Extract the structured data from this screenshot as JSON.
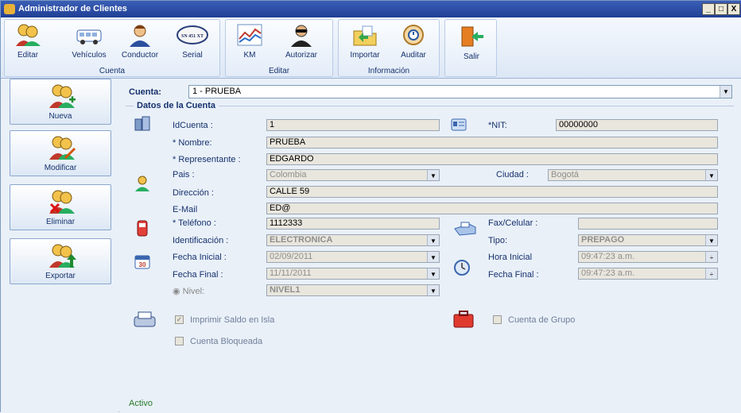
{
  "window": {
    "title": "Administrador de Clientes",
    "controls": [
      "_",
      "□",
      "X"
    ]
  },
  "ribbon": {
    "groups": [
      {
        "title": "Cuenta",
        "buttons": [
          {
            "label": "Editar",
            "icon": "users-icon"
          },
          {
            "label": "Vehículos",
            "icon": "bus-icon"
          },
          {
            "label": "Conductor",
            "icon": "driver-icon"
          },
          {
            "label": "Serial",
            "icon": "serial-tag-icon",
            "badge": "SN 451 XT"
          }
        ]
      },
      {
        "title": "Editar",
        "buttons": [
          {
            "label": "KM",
            "icon": "line-chart-icon"
          },
          {
            "label": "Autorizar",
            "icon": "agent-icon"
          }
        ]
      },
      {
        "title": "Información",
        "buttons": [
          {
            "label": "Importar",
            "icon": "import-folder-icon"
          },
          {
            "label": "Auditar",
            "icon": "audit-clock-icon"
          }
        ]
      },
      {
        "title": "",
        "buttons": [
          {
            "label": "Salir",
            "icon": "exit-door-icon"
          }
        ]
      }
    ]
  },
  "sidebar": {
    "buttons": [
      {
        "label": "Nueva"
      },
      {
        "label": "Modificar"
      },
      {
        "label": "Eliminar"
      },
      {
        "label": "Exportar"
      }
    ]
  },
  "main": {
    "account_label": "Cuenta:",
    "account_value": "1 - PRUEBA",
    "legend": "Datos de la Cuenta",
    "fields": {
      "idcuenta_label": "IdCuenta :",
      "idcuenta_value": "1",
      "nit_label": "*NIT:",
      "nit_value": "00000000",
      "nombre_label": "* Nombre:",
      "nombre_value": "PRUEBA",
      "representante_label": "* Representante :",
      "representante_value": "EDGARDO",
      "pais_label": "Pais :",
      "pais_value": "Colombia",
      "ciudad_label": "Ciudad :",
      "ciudad_value": "Bogotá",
      "direccion_label": "Dirección :",
      "direccion_value": "CALLE 59",
      "email_label": "E-Mail",
      "email_value": "ED@",
      "telefono_label": "* Teléfono :",
      "telefono_value": "1112333",
      "fax_label": "Fax/Celular :",
      "fax_value": "",
      "identificacion_label": "Identificación :",
      "identificacion_value": "ELECTRONICA",
      "tipo_label": "Tipo:",
      "tipo_value": "PREPAGO",
      "fecha_inicial_label": "Fecha Inicial :",
      "fecha_inicial_value": "02/09/2011",
      "hora_inicial_label": "Hora Inicial",
      "hora_inicial_value": "09:47:23 a.m.",
      "fecha_final_label": "Fecha Final :",
      "fecha_final_value": "11/11/2011",
      "fecha_final2_label": "Fecha Final :",
      "fecha_final2_value": "09:47:23 a.m.",
      "nivel_label": "Nivel:",
      "nivel_value": "NIVEL1"
    },
    "checks": {
      "imprimir_label": "Imprimir Saldo en Isla",
      "imprimir_checked": true,
      "grupo_label": "Cuenta de Grupo",
      "grupo_checked": false,
      "bloqueada_label": "Cuenta Bloqueada",
      "bloqueada_checked": false
    },
    "status": "Activo"
  }
}
